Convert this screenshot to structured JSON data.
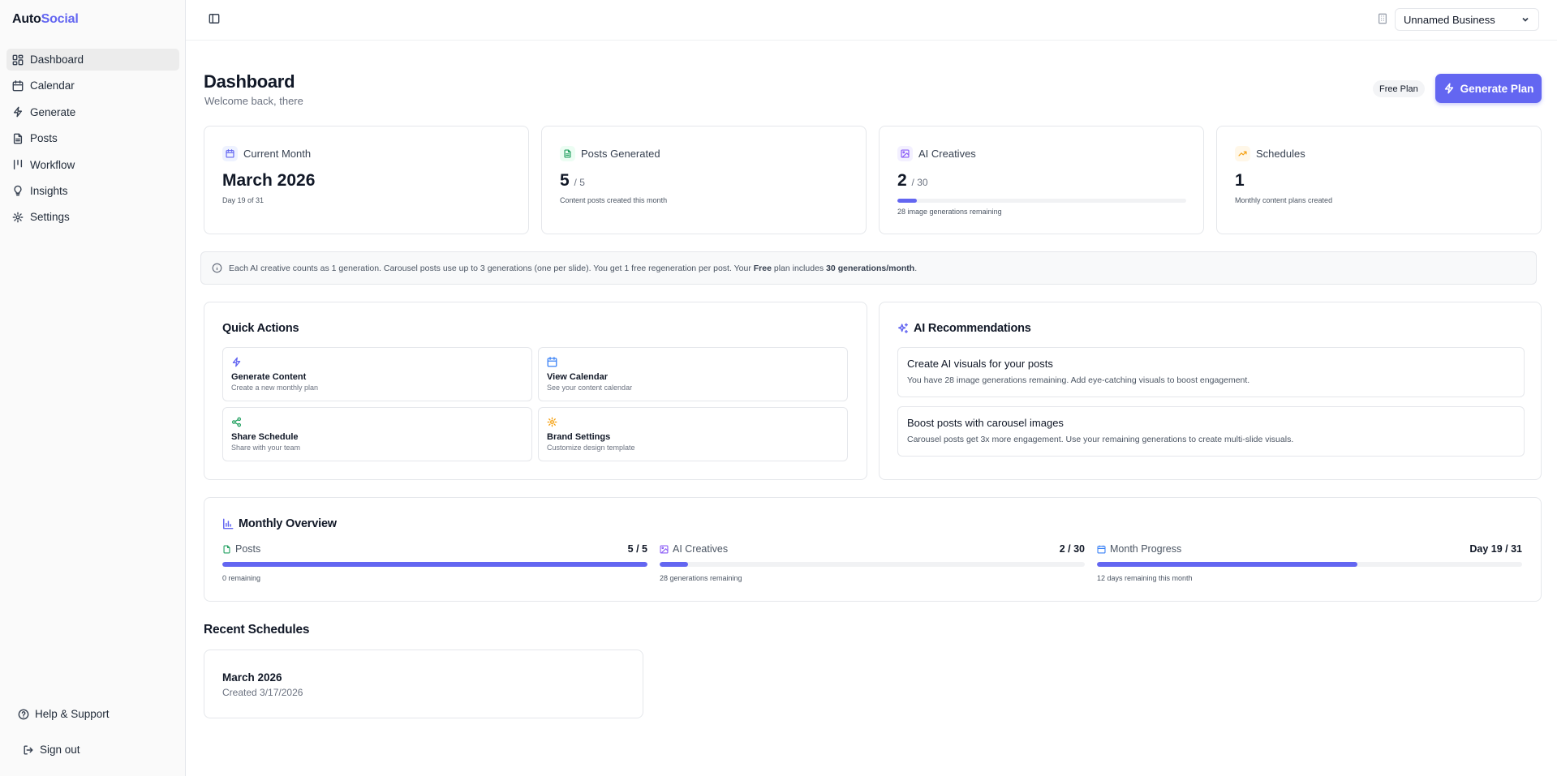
{
  "brand": {
    "name_part1": "Auto",
    "name_part2": "Social",
    "accent_color": "#6366f1"
  },
  "sidebar": {
    "items": [
      {
        "label": "Dashboard",
        "icon": "dashboard-icon",
        "active": true
      },
      {
        "label": "Calendar",
        "icon": "calendar-icon"
      },
      {
        "label": "Generate",
        "icon": "lightning-icon"
      },
      {
        "label": "Posts",
        "icon": "document-icon"
      },
      {
        "label": "Workflow",
        "icon": "workflow-icon"
      },
      {
        "label": "Insights",
        "icon": "lightbulb-icon"
      },
      {
        "label": "Settings",
        "icon": "gear-icon"
      }
    ],
    "help": "Help & Support",
    "signout": "Sign out"
  },
  "topbar": {
    "business": "Unnamed Business"
  },
  "header": {
    "title": "Dashboard",
    "subtitle": "Welcome back, there",
    "plan_badge": "Free Plan",
    "generate_button": "Generate Plan"
  },
  "stats": [
    {
      "label": "Current Month",
      "value": "March 2026",
      "suffix": "",
      "note": "Day 19 of 31",
      "icon": "calendar-icon"
    },
    {
      "label": "Posts Generated",
      "value": "5",
      "suffix": "/ 5",
      "note": "Content posts created this month",
      "icon": "document-icon"
    },
    {
      "label": "AI Creatives",
      "value": "2",
      "suffix": "/ 30",
      "note": "28 image generations remaining",
      "icon": "image-icon",
      "progress": 0.067
    },
    {
      "label": "Schedules",
      "value": "1",
      "suffix": "",
      "note": "Monthly content plans created",
      "icon": "trending-up-icon"
    }
  ],
  "info": {
    "text1": "Each AI creative counts as 1 generation. Carousel posts use up to 3 generations (one per slide). You get 1 free regeneration per post. Your ",
    "plan": "Free",
    "text2": " plan includes ",
    "limit": "30 generations/month",
    "text3": "."
  },
  "quick_actions": {
    "title": "Quick Actions",
    "items": [
      {
        "title": "Generate Content",
        "desc": "Create a new monthly plan",
        "icon": "lightning-icon"
      },
      {
        "title": "View Calendar",
        "desc": "See your content calendar",
        "icon": "calendar-icon"
      },
      {
        "title": "Share Schedule",
        "desc": "Share with your team",
        "icon": "share-icon"
      },
      {
        "title": "Brand Settings",
        "desc": "Customize design template",
        "icon": "gear-icon"
      }
    ]
  },
  "recommendations": {
    "title": "AI Recommendations",
    "items": [
      {
        "title": "Create AI visuals for your posts",
        "desc": "You have 28 image generations remaining. Add eye-catching visuals to boost engagement."
      },
      {
        "title": "Boost posts with carousel images",
        "desc": "Carousel posts get 3x more engagement. Use your remaining generations to create multi-slide visuals."
      }
    ]
  },
  "overview": {
    "title": "Monthly Overview",
    "items": [
      {
        "label": "Posts",
        "value": "5 / 5",
        "note": "0 remaining",
        "progress": 1.0
      },
      {
        "label": "AI Creatives",
        "value": "2 / 30",
        "note": "28 generations remaining",
        "progress": 0.067
      },
      {
        "label": "Month Progress",
        "value": "Day 19 / 31",
        "note": "12 days remaining this month",
        "progress": 0.613
      }
    ]
  },
  "recent": {
    "title": "Recent Schedules",
    "items": [
      {
        "title": "March 2026",
        "created": "Created 3/17/2026"
      }
    ]
  }
}
